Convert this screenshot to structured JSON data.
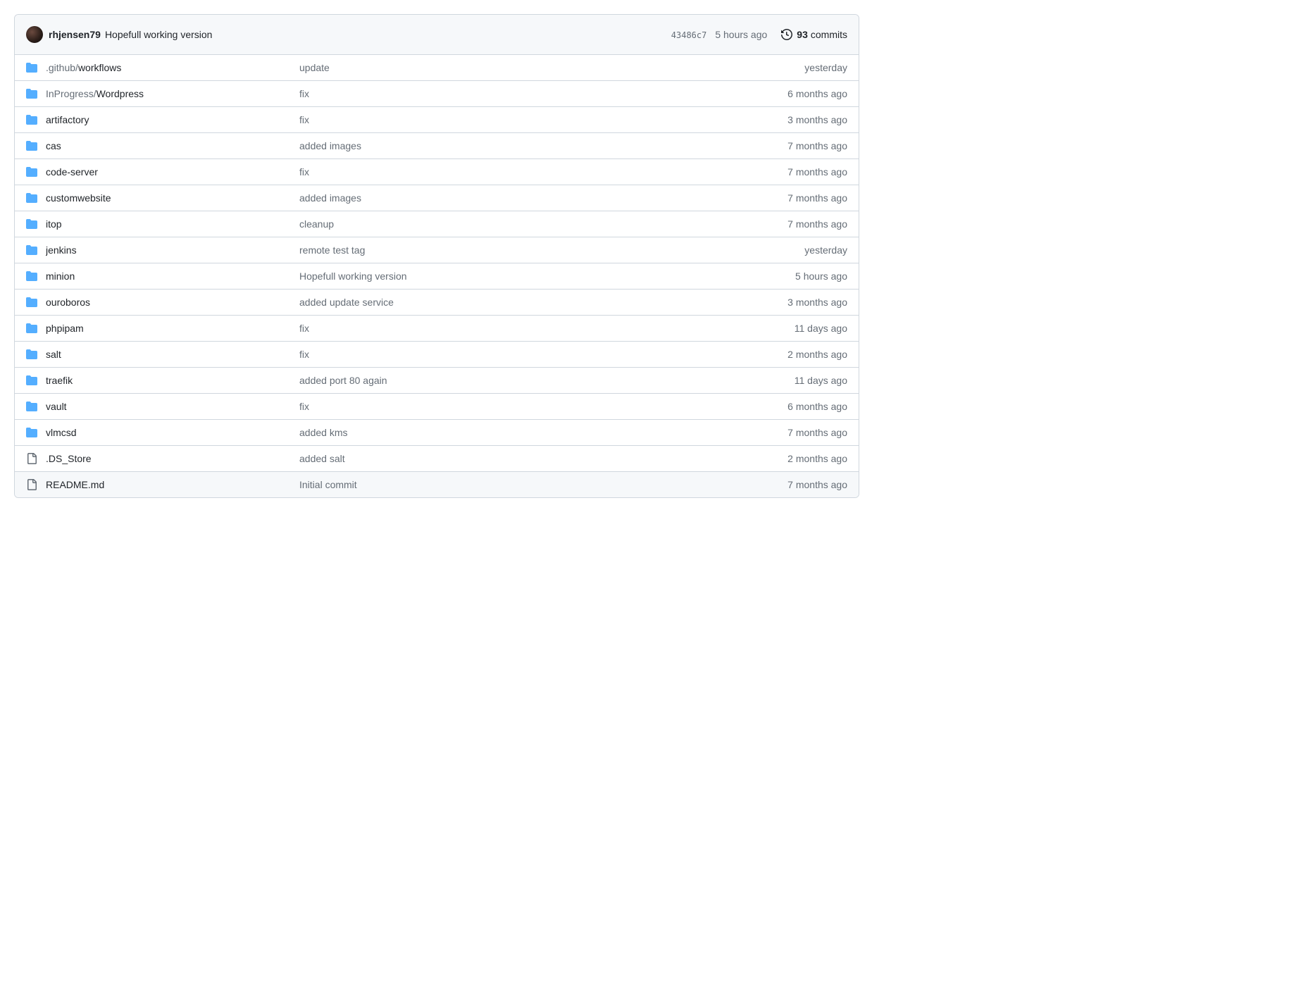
{
  "header": {
    "author": "rhjensen79",
    "message": "Hopefull working version",
    "hash": "43486c7",
    "time": "5 hours ago",
    "commits_count": "93",
    "commits_word": "commits"
  },
  "files": [
    {
      "type": "dir",
      "prefix": ".github/",
      "name": "workflows",
      "msg": "update",
      "age": "yesterday"
    },
    {
      "type": "dir",
      "prefix": "InProgress/",
      "name": "Wordpress",
      "msg": "fix",
      "age": "6 months ago"
    },
    {
      "type": "dir",
      "prefix": "",
      "name": "artifactory",
      "msg": "fix",
      "age": "3 months ago"
    },
    {
      "type": "dir",
      "prefix": "",
      "name": "cas",
      "msg": "added images",
      "age": "7 months ago"
    },
    {
      "type": "dir",
      "prefix": "",
      "name": "code-server",
      "msg": "fix",
      "age": "7 months ago"
    },
    {
      "type": "dir",
      "prefix": "",
      "name": "customwebsite",
      "msg": "added images",
      "age": "7 months ago"
    },
    {
      "type": "dir",
      "prefix": "",
      "name": "itop",
      "msg": "cleanup",
      "age": "7 months ago"
    },
    {
      "type": "dir",
      "prefix": "",
      "name": "jenkins",
      "msg": "remote test tag",
      "age": "yesterday"
    },
    {
      "type": "dir",
      "prefix": "",
      "name": "minion",
      "msg": "Hopefull working version",
      "age": "5 hours ago"
    },
    {
      "type": "dir",
      "prefix": "",
      "name": "ouroboros",
      "msg": "added update service",
      "age": "3 months ago"
    },
    {
      "type": "dir",
      "prefix": "",
      "name": "phpipam",
      "msg": "fix",
      "age": "11 days ago"
    },
    {
      "type": "dir",
      "prefix": "",
      "name": "salt",
      "msg": "fix",
      "age": "2 months ago"
    },
    {
      "type": "dir",
      "prefix": "",
      "name": "traefik",
      "msg": "added port 80 again",
      "age": "11 days ago"
    },
    {
      "type": "dir",
      "prefix": "",
      "name": "vault",
      "msg": "fix",
      "age": "6 months ago"
    },
    {
      "type": "dir",
      "prefix": "",
      "name": "vlmcsd",
      "msg": "added kms",
      "age": "7 months ago"
    },
    {
      "type": "file",
      "prefix": "",
      "name": ".DS_Store",
      "msg": "added salt",
      "age": "2 months ago"
    },
    {
      "type": "file",
      "prefix": "",
      "name": "README.md",
      "msg": "Initial commit",
      "age": "7 months ago"
    }
  ]
}
